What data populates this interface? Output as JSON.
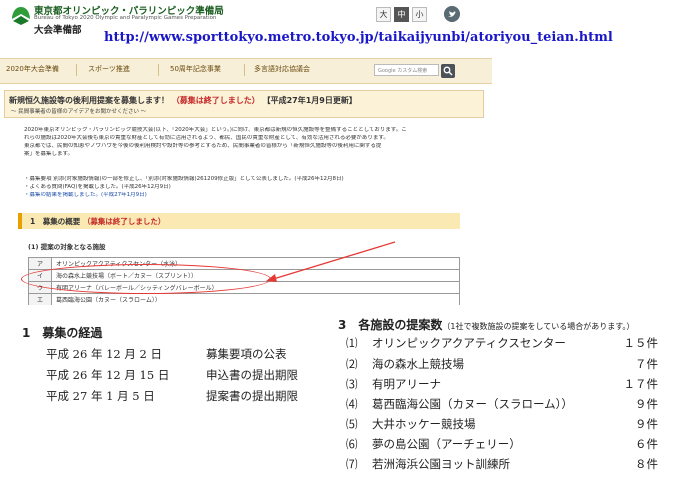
{
  "site": {
    "org_name": "東京都オリンピック・パラリンピック準備局",
    "org_name_en": "Bureau of Tokyo 2020 Olympic and Paralympic Games Preparation",
    "dept": "大会準備部",
    "font_size_large": "大",
    "font_size_medium": "中",
    "font_size_small": "小"
  },
  "url_annotation": "http://www.sporttokyo.metro.tokyo.jp/taikaijyunbi/atoriyou_teian.html",
  "nav": {
    "items": [
      "2020年大会準備",
      "スポーツ推進",
      "50周年記念事業",
      "多言語対応協議会"
    ],
    "search_placeholder": "Google カスタム検索"
  },
  "notice": {
    "title": "新規恒久施設等の後利用提案を募集します！",
    "closed": "（募集は終了しました）",
    "updated": "【平成27年1月9日更新】",
    "subtitle": "～ 民間事業者の皆様のアイデアをお聞かせください ～",
    "para1_line1": "2020年東京オリンピック・パラリンピック競技大会(以下、「2020年大会」という。)に向け、東京都は新規の恒久施設等を整備することとしております。こ",
    "para1_line2": "れらの施設は2020年大会後も東京の貴重な財産として有効に活用されるよう、都民、国民の貴重な財産として、有効な活用される必要があります。",
    "para1_line3": "東京都では、民間の知恵やノウハウを今後の後利用検討や設計等の参考とするため、民間事業者の皆様から「新規恒久施設等の後利用に関する提",
    "para1_line4": "案」を募集します。",
    "bullet1": "・募集要項 別添(対象施設情報)の一部を修正し、「別添(対象施設情報)261209修正版」として公表しました。(平成26年12月8日)",
    "bullet2": "・よくある質問(FAQ)を掲載しました。(平成26年12月9日)",
    "bullet3": "・募集の結果を掲載しました。(平成27年1月9日)"
  },
  "section1": {
    "title": "1　募集の概要",
    "closed": "（募集は終了しました）",
    "subtitle": "(1) 提案の対象となる施設"
  },
  "facility_table": [
    {
      "key": "ア",
      "name": "オリンピックアクアティクスセンター（水泳）"
    },
    {
      "key": "イ",
      "name": "海の森水上競技場（ボート／カヌー（スプリント））"
    },
    {
      "key": "ウ",
      "name": "有明アリーナ（バレーボール／シッティングバレーボール）"
    },
    {
      "key": "エ",
      "name": "葛西臨海公園（カヌー（スラローム））"
    }
  ],
  "process": {
    "heading": "1　募集の経過",
    "rows": [
      {
        "date": "平成 26 年 12 月  2 日",
        "event": "募集要項の公表"
      },
      {
        "date": "平成 26 年 12 月 15 日",
        "event": "申込書の提出期限"
      },
      {
        "date": "平成 27 年  1 月  5 日",
        "event": "提案書の提出期限"
      }
    ]
  },
  "proposals": {
    "heading": "3　各施設の提案数",
    "note": "（1社で複数施設の提案をしている場合があります。）",
    "rows": [
      {
        "no": "⑴",
        "facility": "オリンピックアクアティクスセンター",
        "count": "１５件"
      },
      {
        "no": "⑵",
        "facility": "海の森水上競技場",
        "count": "７件"
      },
      {
        "no": "⑶",
        "facility": "有明アリーナ",
        "count": "１７件"
      },
      {
        "no": "⑷",
        "facility": "葛西臨海公園（カヌー（スラローム））",
        "count": "９件"
      },
      {
        "no": "⑸",
        "facility": "大井ホッケー競技場",
        "count": "９件"
      },
      {
        "no": "⑹",
        "facility": "夢の島公園（アーチェリー）",
        "count": "６件"
      },
      {
        "no": "⑺",
        "facility": "若洲海浜公園ヨット訓練所",
        "count": "８件"
      }
    ]
  },
  "colors": {
    "accent": "#e7a000",
    "link": "#1a17c9",
    "alert": "#c62828",
    "brand": "#1b5e20"
  }
}
